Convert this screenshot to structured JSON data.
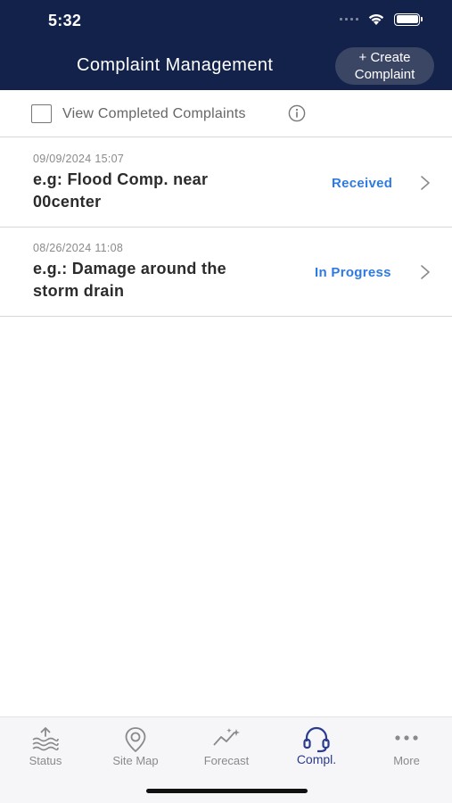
{
  "status_bar": {
    "time": "5:32"
  },
  "header": {
    "title": "Complaint Management",
    "create_button_line1": "+ Create",
    "create_button_line2": "Complaint"
  },
  "filter": {
    "label": "View Completed Complaints",
    "checked": false
  },
  "complaints": [
    {
      "date": "09/09/2024 15:07",
      "title_line1": "e.g: Flood Comp. near",
      "title_line2": "00center",
      "status": "Received"
    },
    {
      "date": "08/26/2024 11:08",
      "title_line1": "e.g.: Damage around the",
      "title_line2": "storm drain",
      "status": "In Progress"
    }
  ],
  "tabbar": {
    "items": [
      {
        "label": "Status",
        "icon": "water-level-icon"
      },
      {
        "label": "Site Map",
        "icon": "map-pin-icon"
      },
      {
        "label": "Forecast",
        "icon": "forecast-chart-icon"
      },
      {
        "label": "Compl.",
        "icon": "headset-icon"
      },
      {
        "label": "More",
        "icon": "more-dots-icon"
      }
    ],
    "active": "Compl."
  },
  "colors": {
    "header_bg": "#13224a",
    "status_blue": "#2f7ae0",
    "active_tab": "#2a3a8f"
  }
}
